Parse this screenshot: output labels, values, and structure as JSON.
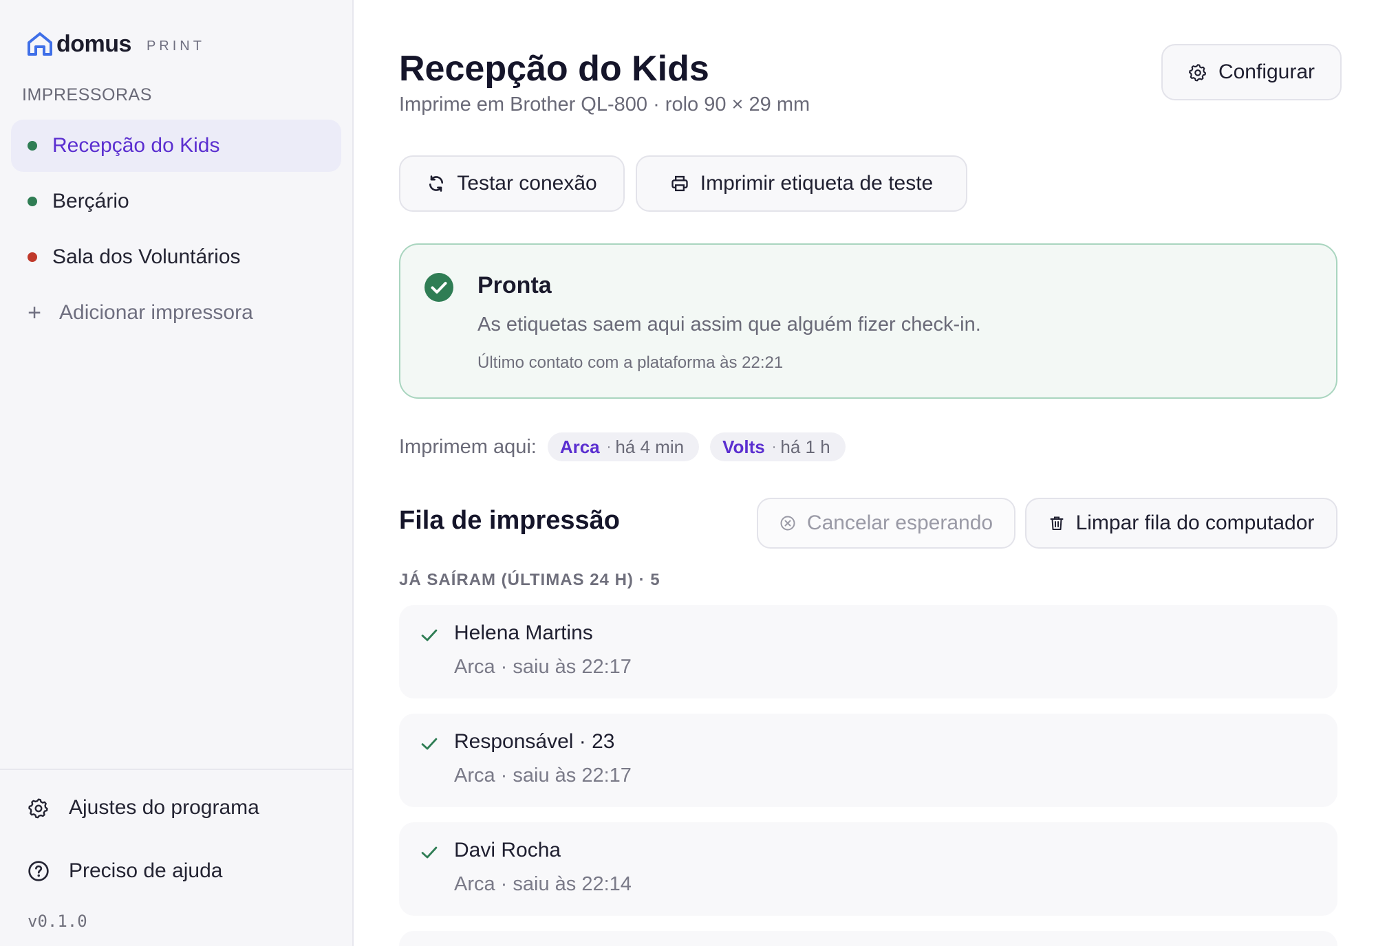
{
  "brand": {
    "name": "domus",
    "suffix": "PRINT"
  },
  "sidebar": {
    "section_label": "IMPRESSORAS",
    "printers": [
      {
        "label": "Recepção do Kids",
        "status_color": "#2f7d54",
        "active": true
      },
      {
        "label": "Berçário",
        "status_color": "#2f7d54",
        "active": false
      },
      {
        "label": "Sala dos Voluntários",
        "status_color": "#c0392b",
        "active": false
      }
    ],
    "add_printer": "Adicionar impressora",
    "settings": "Ajustes do programa",
    "help": "Preciso de ajuda",
    "version": "v0.1.0"
  },
  "header": {
    "title": "Recepção do Kids",
    "subtitle": "Imprime em Brother QL-800 · rolo 90 × 29 mm",
    "configure": "Configurar"
  },
  "actions": {
    "test_connection": "Testar conexão",
    "print_test_label": "Imprimir etiqueta de teste"
  },
  "status": {
    "title": "Pronta",
    "description": "As etiquetas saem aqui assim que alguém fizer check-in.",
    "last_contact": "Último contato com a plataforma às 22:21",
    "color": "#2f7d54"
  },
  "printers_here": {
    "label": "Imprimem aqui:",
    "sources": [
      {
        "name": "Arca",
        "time": "há 4 min"
      },
      {
        "name": "Volts",
        "time": "há 1 h"
      }
    ]
  },
  "queue": {
    "title": "Fila de impressão",
    "cancel_waiting": "Cancelar esperando",
    "clear_queue": "Limpar fila do computador",
    "done_label": "JÁ SAÍRAM (ÚLTIMAS 24 H) · 5",
    "jobs": [
      {
        "name": "Helena Martins",
        "meta": "Arca · saiu às 22:17"
      },
      {
        "name": "Responsável · 23",
        "meta": "Arca · saiu às 22:17"
      },
      {
        "name": "Davi Rocha",
        "meta": "Arca · saiu às 22:14"
      }
    ]
  },
  "colors": {
    "accent": "#5b2fd0",
    "success": "#2f7d54",
    "error": "#c0392b"
  }
}
